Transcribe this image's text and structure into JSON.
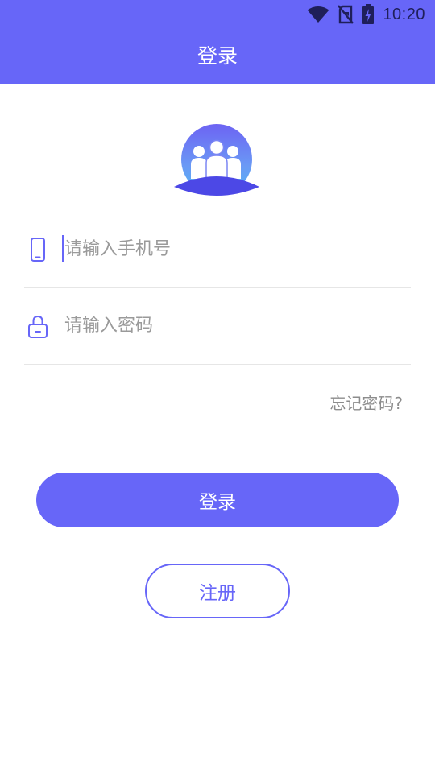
{
  "status_bar": {
    "time": "10:20",
    "icons": [
      "wifi-icon",
      "no-sim-icon",
      "battery-charging-icon"
    ]
  },
  "header": {
    "title": "登录"
  },
  "logo": {
    "icon": "users-group-icon"
  },
  "form": {
    "phone": {
      "icon": "phone-icon",
      "placeholder": "请输入手机号",
      "value": ""
    },
    "password": {
      "icon": "lock-icon",
      "placeholder": "请输入密码",
      "value": ""
    },
    "forgot_label": "忘记密码?"
  },
  "buttons": {
    "login_label": "登录",
    "register_label": "注册"
  },
  "colors": {
    "primary": "#6766f8",
    "status_icons": "#1f1f5a",
    "placeholder": "#9a9a9a",
    "divider": "#e6e6e6"
  }
}
